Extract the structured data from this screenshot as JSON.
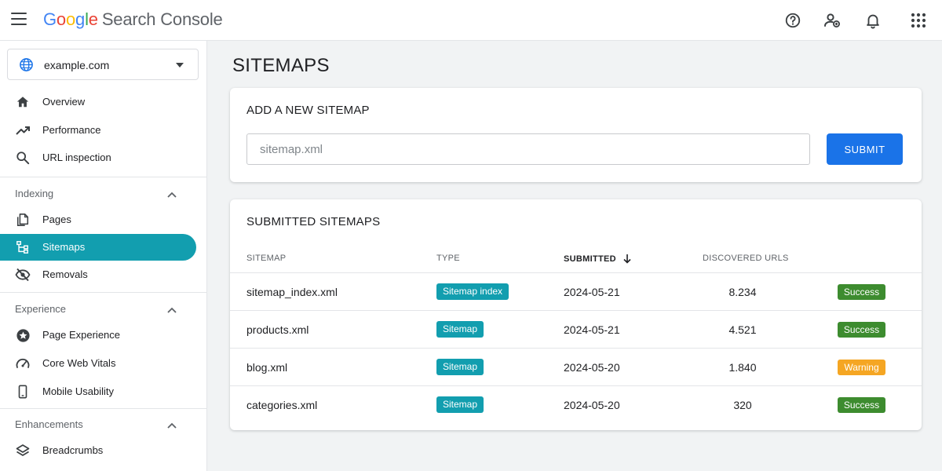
{
  "app": {
    "logo_letters": [
      "G",
      "o",
      "o",
      "g",
      "l",
      "e"
    ],
    "product_name": "Search Console"
  },
  "property": {
    "name": "example.com"
  },
  "nav": {
    "top_items": [
      {
        "label": "Overview",
        "icon": "home-icon"
      },
      {
        "label": "Performance",
        "icon": "trending-up-icon"
      },
      {
        "label": "URL inspection",
        "icon": "search-icon"
      }
    ],
    "sections": [
      {
        "label": "Indexing",
        "items": [
          {
            "label": "Pages",
            "icon": "pages-icon"
          },
          {
            "label": "Sitemaps",
            "icon": "sitemap-icon",
            "active": true
          },
          {
            "label": "Removals",
            "icon": "eye-off-icon"
          }
        ]
      },
      {
        "label": "Experience",
        "items": [
          {
            "label": "Page Experience",
            "icon": "star-badge-icon"
          },
          {
            "label": "Core Web Vitals",
            "icon": "gauge-icon"
          },
          {
            "label": "Mobile Usability",
            "icon": "phone-icon"
          }
        ]
      },
      {
        "label": "Enhancements",
        "items": [
          {
            "label": "Breadcrumbs",
            "icon": "layers-icon"
          }
        ]
      }
    ]
  },
  "main": {
    "page_title": "SITEMAPS",
    "add_sitemap": {
      "title": "ADD A NEW SITEMAP",
      "placeholder": "sitemap.xml",
      "submit_label": "SUBMIT"
    },
    "submitted": {
      "title": "SUBMITTED SITEMAPS",
      "columns": [
        "SITEMAP",
        "TYPE",
        "SUBMITTED",
        "DISCOVERED URLS"
      ],
      "rows": [
        {
          "sitemap": "sitemap_index.xml",
          "type": "Sitemap index",
          "submitted": "2024-05-21",
          "discovered": "8.234",
          "status": "Success"
        },
        {
          "sitemap": "products.xml",
          "type": "Sitemap",
          "submitted": "2024-05-21",
          "discovered": "4.521",
          "status": "Success"
        },
        {
          "sitemap": "blog.xml",
          "type": "Sitemap",
          "submitted": "2024-05-20",
          "discovered": "1.840",
          "status": "Warning"
        },
        {
          "sitemap": "categories.xml",
          "type": "Sitemap",
          "submitted": "2024-05-20",
          "discovered": "320",
          "status": "Success"
        }
      ]
    }
  },
  "colors": {
    "accent": "#129eaf",
    "primary_button": "#1a73e8",
    "status_success": "#3d8c2f",
    "status_warning": "#f5a623"
  }
}
